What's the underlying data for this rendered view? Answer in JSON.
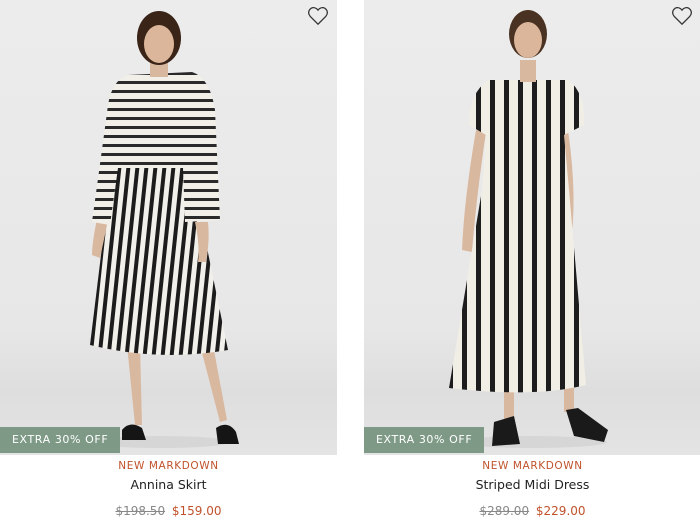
{
  "colors": {
    "badge_bg": "#7e9a86",
    "sale": "#c0522b",
    "strike": "#888888",
    "text": "#222222"
  },
  "products": [
    {
      "badge": "EXTRA 30% OFF",
      "tag": "NEW MARKDOWN",
      "name": "Annina Skirt",
      "original_price": "$198.50",
      "sale_price": "$159.00",
      "wishlist_icon": "heart-icon"
    },
    {
      "badge": "EXTRA 30% OFF",
      "tag": "NEW MARKDOWN",
      "name": "Striped Midi Dress",
      "original_price": "$289.00",
      "sale_price": "$229.00",
      "wishlist_icon": "heart-icon"
    }
  ]
}
